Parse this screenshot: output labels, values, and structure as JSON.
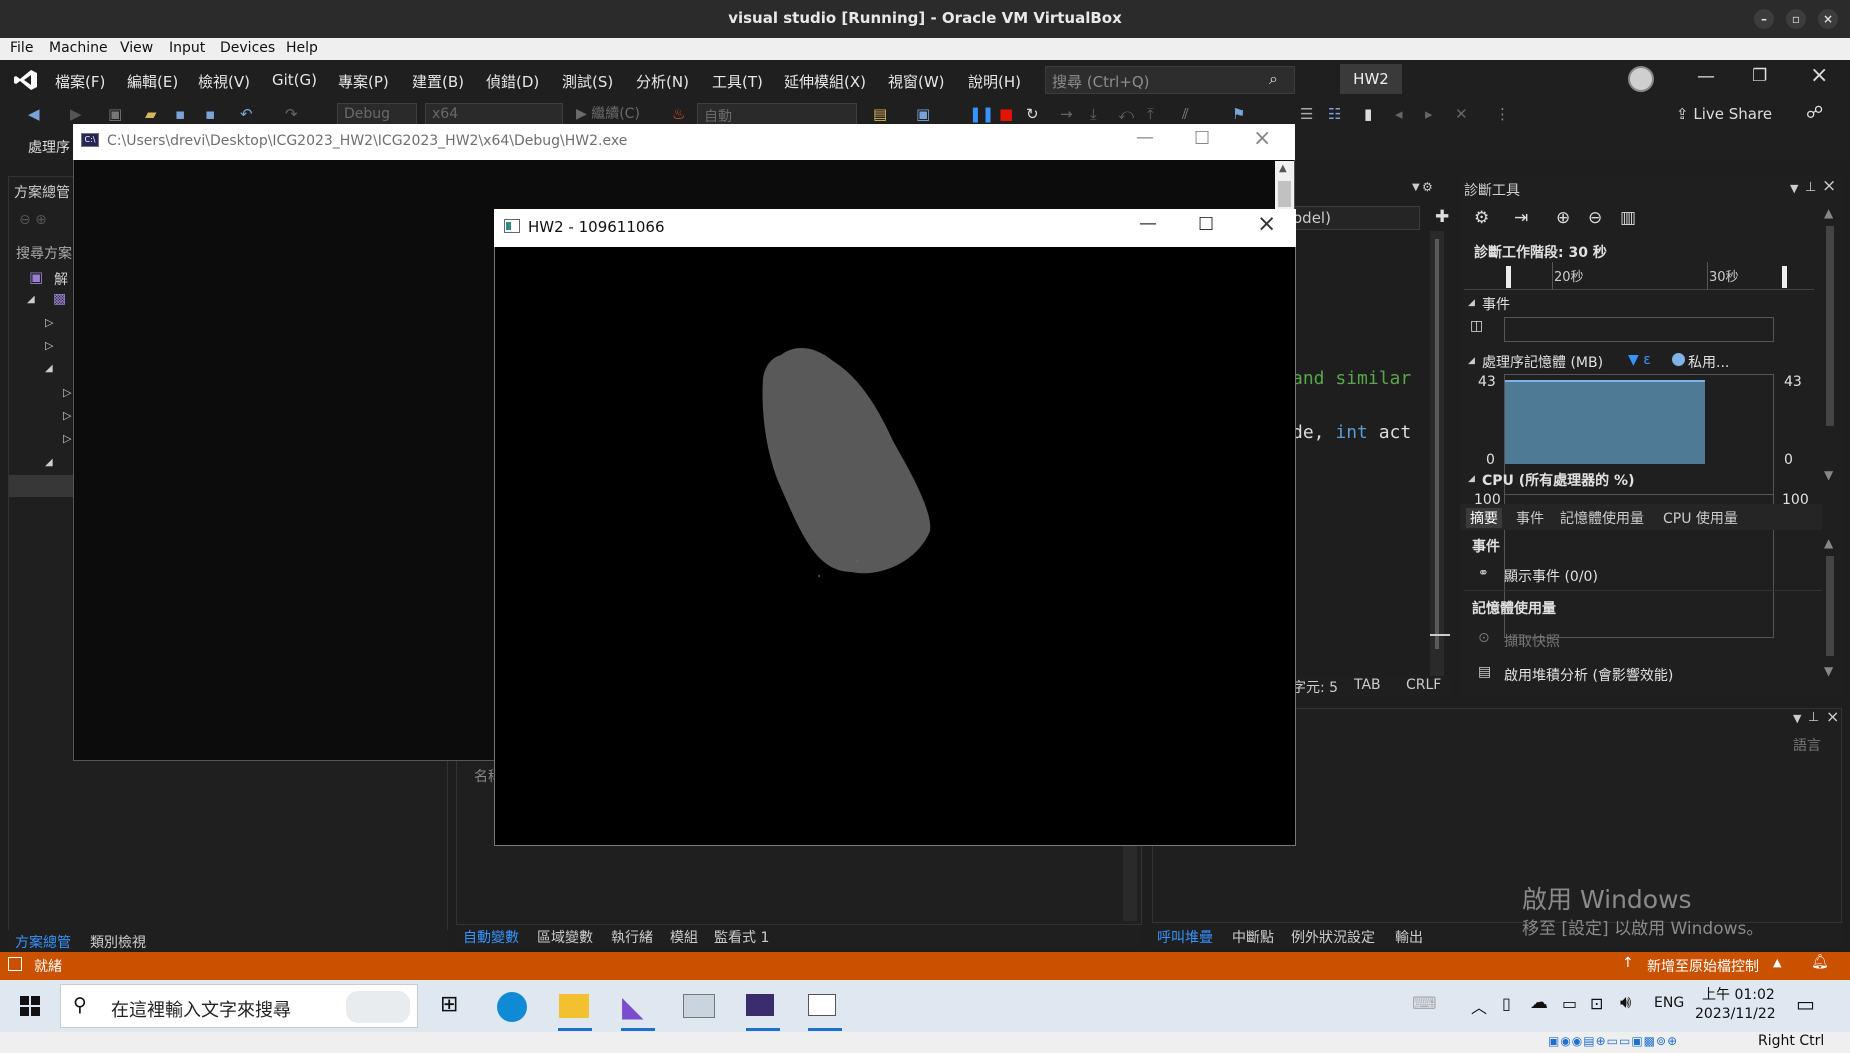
{
  "host": {
    "title": "visual studio [Running] - Oracle VM VirtualBox",
    "menu": [
      "File",
      "Machine",
      "View",
      "Input",
      "Devices",
      "Help"
    ],
    "right_ctrl": "Right Ctrl"
  },
  "vs": {
    "menu": [
      "檔案(F)",
      "編輯(E)",
      "檢視(V)",
      "Git(G)",
      "專案(P)",
      "建置(B)",
      "偵錯(D)",
      "測試(S)",
      "分析(N)",
      "工具(T)",
      "延伸模組(X)",
      "視窗(W)",
      "說明(H)"
    ],
    "search_placeholder": "搜尋 (Ctrl+Q)",
    "solution_name": "HW2",
    "live_share": "Live Share",
    "config_combo": "Debug",
    "platform_combo": "x64",
    "continue_label": "繼續(C)",
    "auto_combo": "自動",
    "process_label": "處理序",
    "solution_explorer": {
      "title": "方案總管",
      "search_label": "搜尋方案",
      "solution_node": "解",
      "bottom_tabs": [
        "方案總管",
        "類別檢視"
      ]
    },
    "editor": {
      "dropdown": "odel)",
      "code_line1": "and similar",
      "code_line2_a": "de, ",
      "code_line2_kw": "int",
      "code_line2_b": " act",
      "status_col": "字元: 5",
      "status_tab": "TAB",
      "status_crlf": "CRLF"
    },
    "locals": {
      "name_header": "名稱",
      "tabs": [
        "自動變數",
        "區域變數",
        "執行緒",
        "模組",
        "監看式 1"
      ]
    },
    "callstack": {
      "lang_header": "語言",
      "tabs": [
        "呼叫堆疊",
        "中斷點",
        "例外狀況設定",
        "輸出"
      ]
    },
    "diagnostics": {
      "title": "診斷工具",
      "session": "診斷工作階段: 30 秒",
      "tick_20": "20秒",
      "tick_30": "30秒",
      "events_label": "事件",
      "memory_label": "處理序記憶體 (MB)",
      "memory_legend_1": "▼ ε",
      "memory_legend_2": "私用...",
      "mem_max": "43",
      "mem_min": "0",
      "cpu_label": "CPU (所有處理器的 %)",
      "cpu_max": "100",
      "tabs": [
        "摘要",
        "事件",
        "記憶體使用量",
        "CPU 使用量"
      ],
      "events_section": "事件",
      "show_events": "顯示事件 (0/0)",
      "memory_section": "記憶體使用量",
      "take_snapshot": "擷取快照",
      "heap_profiling": "啟用堆積分析 (會影響效能)"
    },
    "status": {
      "ready": "就緒",
      "source_control": "新增至原始檔控制"
    },
    "watermark_1": "啟用 Windows",
    "watermark_2": "移至 [設定] 以啟用 Windows。"
  },
  "console_window": {
    "title": "C:\\Users\\drevi\\Desktop\\ICG2023_HW2\\ICG2023_HW2\\x64\\Debug\\HW2.exe"
  },
  "hw2_window": {
    "title": "HW2 - 109611066",
    "shape_color": "#595959"
  },
  "taskbar": {
    "search_placeholder": "在這裡輸入文字來搜尋",
    "lang": "ENG",
    "time": "上午 01:02",
    "date": "2023/11/22"
  },
  "colors": {
    "vs_bg": "#1f1f1f",
    "status_orange": "#ca5100",
    "memory_fill": "#4f7a96",
    "accent_blue": "#3794ff"
  }
}
